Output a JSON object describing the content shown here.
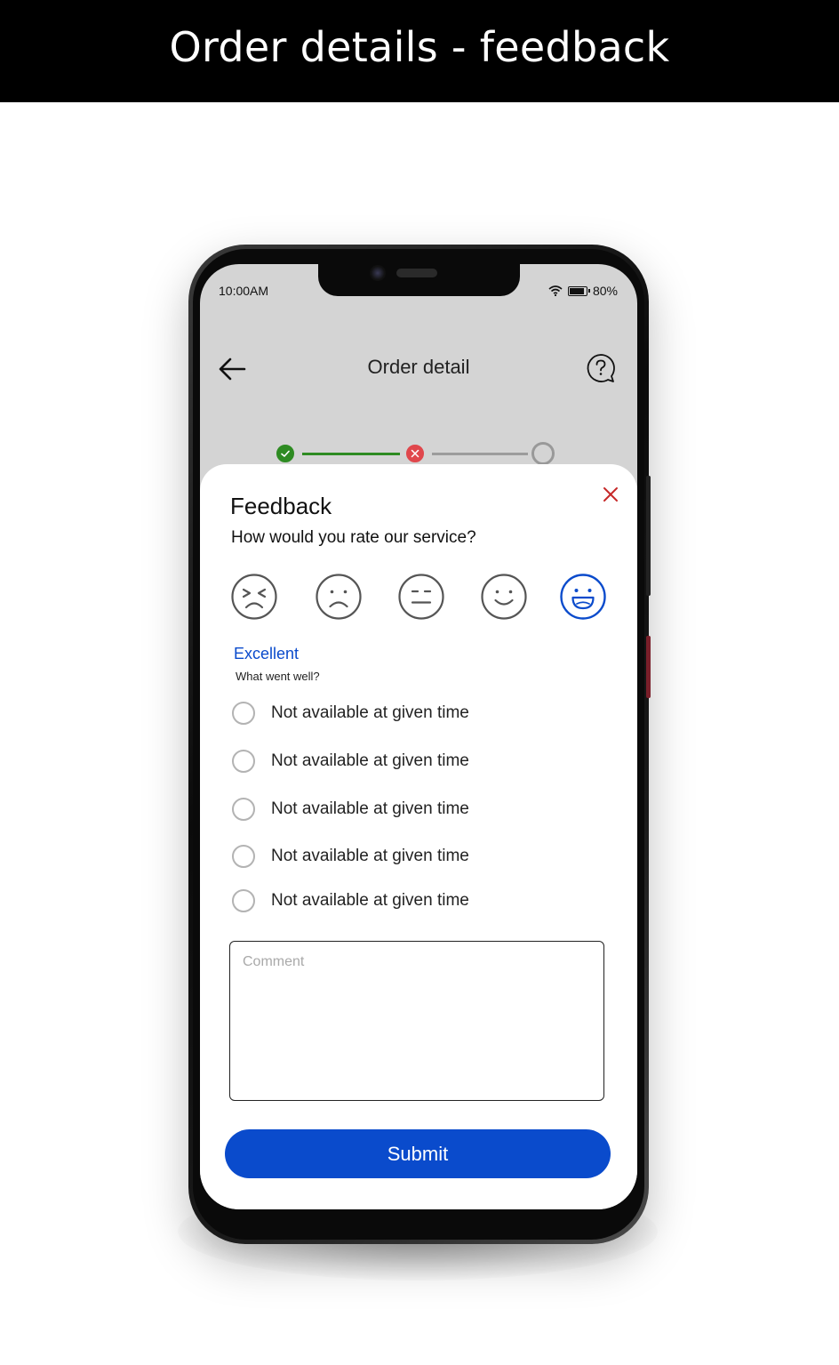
{
  "banner": {
    "title": "Order details - feedback"
  },
  "status_bar": {
    "time": "10:00AM",
    "battery": "80%",
    "battery_level": 0.8
  },
  "app_bar": {
    "title": "Order detail",
    "back_icon": "arrow-left-icon",
    "help_icon": "help-chat-icon"
  },
  "stepper": {
    "steps": [
      {
        "state": "completed",
        "icon": "check-icon",
        "color": "#2e8b22"
      },
      {
        "state": "failed",
        "icon": "cross-icon",
        "color": "#e0474c"
      },
      {
        "state": "pending",
        "icon": "empty-circle-icon",
        "color": "#999999"
      }
    ]
  },
  "feedback": {
    "title": "Feedback",
    "question": "How would you rate our service?",
    "faces": [
      "very-dissatisfied-face-icon",
      "dissatisfied-face-icon",
      "neutral-face-icon",
      "satisfied-face-icon",
      "very-satisfied-face-icon"
    ],
    "selected_face_index": 4,
    "rating_label": "Excellent",
    "subheading": "What went well?",
    "options": [
      "Not available at given time",
      "Not available at given time",
      "Not available at given time",
      "Not available at given time",
      "Not available at given time"
    ],
    "comment_placeholder": "Comment",
    "submit_label": "Submit"
  },
  "colors": {
    "accent": "#0a4bcc",
    "close": "#c62828",
    "success": "#2e8b22",
    "error": "#e0474c"
  }
}
